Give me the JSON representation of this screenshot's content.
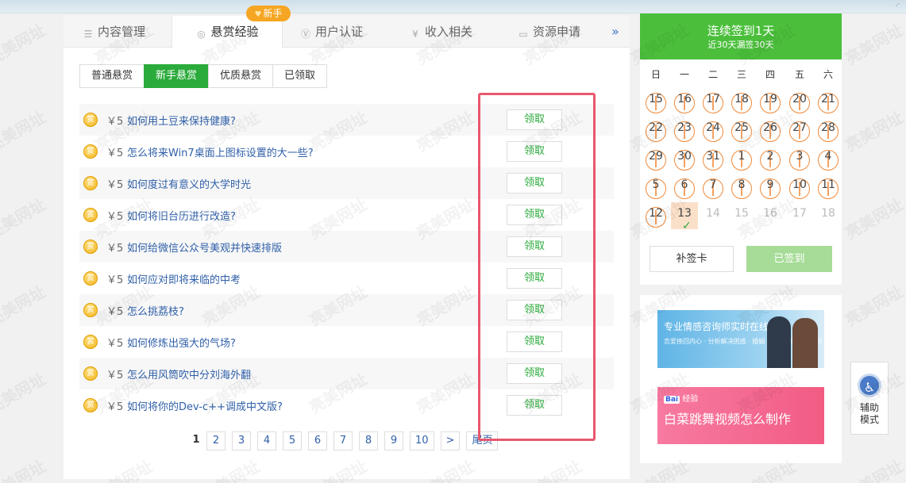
{
  "tabs": [
    {
      "label": "内容管理",
      "icon": "list-icon"
    },
    {
      "label": "悬赏经验",
      "icon": "reward-icon"
    },
    {
      "label": "用户认证",
      "icon": "verify-icon"
    },
    {
      "label": "收入相关",
      "icon": "yen-icon"
    },
    {
      "label": "资源申请",
      "icon": "monitor-icon"
    }
  ],
  "new_badge": "新手",
  "more_label": "»",
  "subtabs": [
    "普通悬赏",
    "新手悬赏",
    "优质悬赏",
    "已领取"
  ],
  "active_subtab": 1,
  "questions": [
    {
      "reward": "￥5",
      "title": "如何用土豆来保持健康?",
      "action": "领取"
    },
    {
      "reward": "￥5",
      "title": "怎么将来Win7桌面上图标设置的大一些?",
      "action": "领取"
    },
    {
      "reward": "￥5",
      "title": "如何度过有意义的大学时光",
      "action": "领取"
    },
    {
      "reward": "￥5",
      "title": "如何将旧台历进行改造?",
      "action": "领取"
    },
    {
      "reward": "￥5",
      "title": "如何给微信公众号美观并快速排版",
      "action": "领取"
    },
    {
      "reward": "￥5",
      "title": "如何应对即将来临的中考",
      "action": "领取"
    },
    {
      "reward": "￥5",
      "title": "怎么挑荔枝?",
      "action": "领取"
    },
    {
      "reward": "￥5",
      "title": "如何修炼出强大的气场?",
      "action": "领取"
    },
    {
      "reward": "￥5",
      "title": "怎么用风筒吹中分刘海外翻",
      "action": "领取"
    },
    {
      "reward": "￥5",
      "title": "如何将你的Dev-c++调成中文版?",
      "action": "领取"
    }
  ],
  "coin_label": "赏",
  "pagination": {
    "current": "1",
    "pages": [
      "2",
      "3",
      "4",
      "5",
      "6",
      "7",
      "8",
      "9",
      "10"
    ],
    "next": ">",
    "last": "尾页"
  },
  "signin": {
    "title": "连续签到1天",
    "subtitle": "近30天漏签30天",
    "weekdays": [
      "日",
      "一",
      "二",
      "三",
      "四",
      "五",
      "六"
    ],
    "days": [
      {
        "n": "15",
        "state": "missed"
      },
      {
        "n": "16",
        "state": "missed"
      },
      {
        "n": "17",
        "state": "missed"
      },
      {
        "n": "18",
        "state": "missed"
      },
      {
        "n": "19",
        "state": "missed"
      },
      {
        "n": "20",
        "state": "missed"
      },
      {
        "n": "21",
        "state": "missed"
      },
      {
        "n": "22",
        "state": "missed"
      },
      {
        "n": "23",
        "state": "missed"
      },
      {
        "n": "24",
        "state": "missed"
      },
      {
        "n": "25",
        "state": "missed"
      },
      {
        "n": "26",
        "state": "missed"
      },
      {
        "n": "27",
        "state": "missed"
      },
      {
        "n": "28",
        "state": "missed"
      },
      {
        "n": "29",
        "state": "missed"
      },
      {
        "n": "30",
        "state": "missed"
      },
      {
        "n": "31",
        "state": "missed"
      },
      {
        "n": "1",
        "state": "missed"
      },
      {
        "n": "2",
        "state": "missed"
      },
      {
        "n": "3",
        "state": "missed"
      },
      {
        "n": "4",
        "state": "missed"
      },
      {
        "n": "5",
        "state": "missed"
      },
      {
        "n": "6",
        "state": "missed"
      },
      {
        "n": "7",
        "state": "missed"
      },
      {
        "n": "8",
        "state": "missed"
      },
      {
        "n": "9",
        "state": "missed"
      },
      {
        "n": "10",
        "state": "missed"
      },
      {
        "n": "11",
        "state": "missed"
      },
      {
        "n": "12",
        "state": "missed"
      },
      {
        "n": "13",
        "state": "today"
      },
      {
        "n": "14",
        "state": "future"
      },
      {
        "n": "15",
        "state": "future"
      },
      {
        "n": "16",
        "state": "future"
      },
      {
        "n": "17",
        "state": "future"
      },
      {
        "n": "18",
        "state": "future"
      }
    ],
    "makeup_label": "补签卡",
    "signed_label": "已签到"
  },
  "ads": {
    "ad1_text": "专业情感咨询师实时在线答疑",
    "ad1_sub": "恋爱挽回内心 · 分析解决困惑 · 婚姻 · 心理服务在线提问",
    "ad2_brand_logo": "Bai",
    "ad2_brand": "经验",
    "ad2_text": "白菜跳舞视频怎么制作"
  },
  "assist": {
    "label_line1": "辅助",
    "label_line2": "模式"
  },
  "watermark_text": "亮美网址",
  "colors": {
    "accent": "#2bab3b",
    "header_green": "#4bbf3c",
    "highlight": "#e8586d",
    "link": "#2f5fa8",
    "badge": "#f6a623"
  }
}
